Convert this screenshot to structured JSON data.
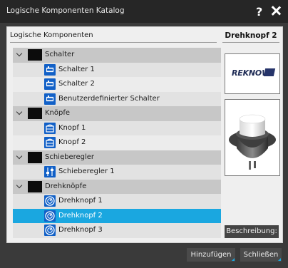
{
  "window": {
    "title": "Logische Komponenten Katalog",
    "help": "?"
  },
  "tree_header": "Logische Komponenten",
  "tree": [
    {
      "type": "category",
      "label": "Schalter",
      "icon": "chevron-down-icon"
    },
    {
      "type": "item",
      "label": "Schalter 1",
      "icon": "switch-icon"
    },
    {
      "type": "item",
      "label": "Schalter 2",
      "icon": "switch-icon"
    },
    {
      "type": "item",
      "label": "Benutzerdefinierter Schalter",
      "icon": "switch-icon"
    },
    {
      "type": "category",
      "label": "Knöpfe",
      "icon": "chevron-down-icon"
    },
    {
      "type": "item",
      "label": "Knopf 1",
      "icon": "button-icon"
    },
    {
      "type": "item",
      "label": "Knopf 2",
      "icon": "button-icon"
    },
    {
      "type": "category",
      "label": "Schieberegler",
      "icon": "chevron-down-icon"
    },
    {
      "type": "item",
      "label": "Schieberegler 1",
      "icon": "slider-icon"
    },
    {
      "type": "category",
      "label": "Drehknöpfe",
      "icon": "chevron-down-icon"
    },
    {
      "type": "item",
      "label": "Drehknopf 1",
      "icon": "rotary-knob-icon"
    },
    {
      "type": "item",
      "label": "Drehknopf 2",
      "icon": "rotary-knob-icon",
      "selected": true
    },
    {
      "type": "item",
      "label": "Drehknopf 3",
      "icon": "rotary-knob-icon"
    }
  ],
  "preview": {
    "title": "Drehknopf 2",
    "logo_text": "REKNOW",
    "description_button": "Beschreibung:"
  },
  "footer": {
    "add_button": "Hinzufügen",
    "close_button": "Schließen"
  },
  "colors": {
    "selection": "#1aa7e0",
    "icon_blue": "#1160c7",
    "title_bar": "#262626"
  }
}
